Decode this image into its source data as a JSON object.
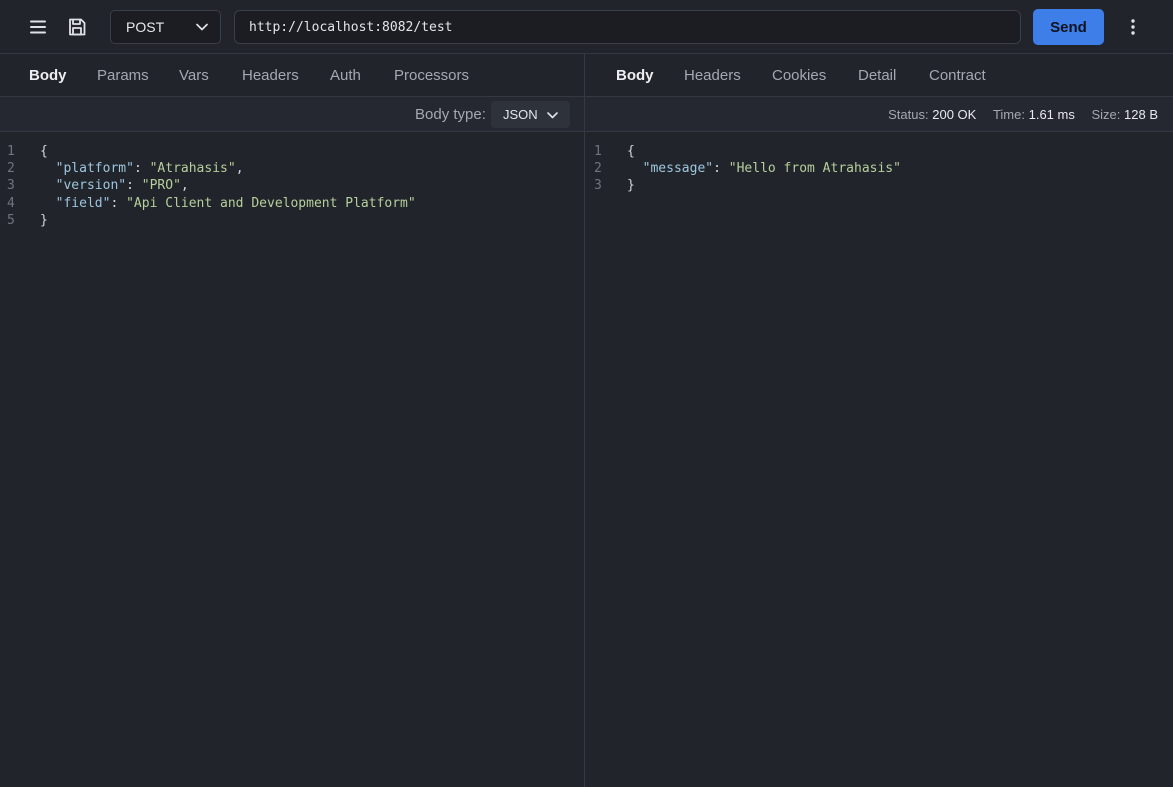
{
  "toolbar": {
    "method": "POST",
    "url": "http://localhost:8082/test",
    "send_label": "Send"
  },
  "request": {
    "tabs": [
      "Body",
      "Params",
      "Vars",
      "Headers",
      "Auth",
      "Processors"
    ],
    "active_tab": "Body",
    "body_type_label": "Body type:",
    "body_type": "JSON",
    "lines": [
      {
        "num": "1",
        "text": "{"
      },
      {
        "num": "2",
        "key": "\"platform\"",
        "value": "\"Atrahasis\"",
        "comma": true
      },
      {
        "num": "3",
        "key": "\"version\"",
        "value": "\"PRO\"",
        "comma": true
      },
      {
        "num": "4",
        "key": "\"field\"",
        "value": "\"Api Client and Development Platform\"",
        "comma": false
      },
      {
        "num": "5",
        "text": "}"
      }
    ]
  },
  "response": {
    "tabs": [
      "Body",
      "Headers",
      "Cookies",
      "Detail",
      "Contract"
    ],
    "active_tab": "Body",
    "status_label": "Status:",
    "status_value": "200 OK",
    "time_label": "Time:",
    "time_value": "1.61 ms",
    "size_label": "Size:",
    "size_value": "128 B",
    "lines": [
      {
        "num": "1",
        "text": "{"
      },
      {
        "num": "2",
        "key": "\"message\"",
        "value": "\"Hello from Atrahasis\"",
        "comma": false
      },
      {
        "num": "3",
        "text": "}"
      }
    ]
  },
  "colors": {
    "background": "#21242b",
    "accent": "#3e7ee8",
    "json_key": "#9dc6de",
    "json_string": "#b6cf9b"
  },
  "icons": {
    "menu": "hamburger-menu-icon",
    "save": "floppy-disk-icon",
    "more": "vertical-dots-icon",
    "dropdown": "chevron-down-icon"
  }
}
